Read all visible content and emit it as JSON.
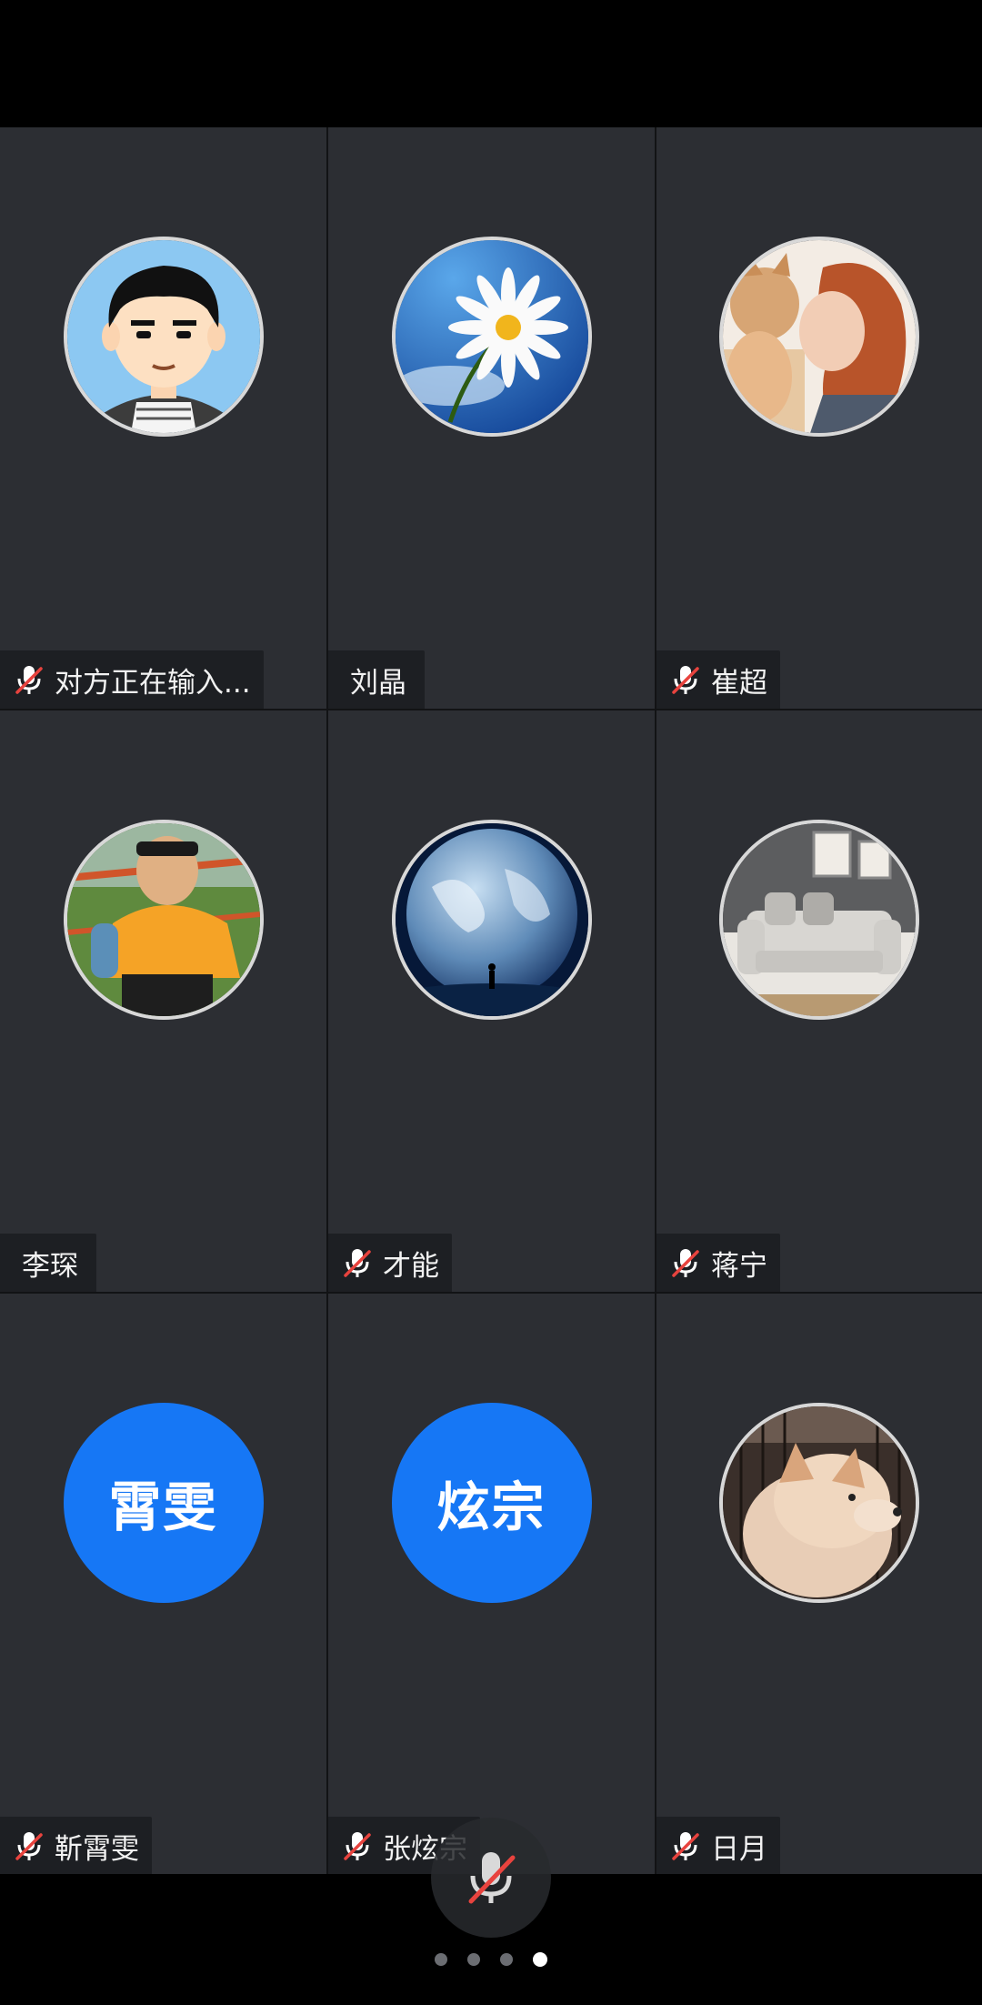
{
  "participants": [
    {
      "name": "对方正在输入...",
      "muted": true,
      "avatar": "cartoon-boy"
    },
    {
      "name": "刘晶",
      "muted": false,
      "avatar": "daisy-sky"
    },
    {
      "name": "崔超",
      "muted": true,
      "avatar": "woman-cat"
    },
    {
      "name": "李琛",
      "muted": false,
      "avatar": "kid-orange-shirt"
    },
    {
      "name": "才能",
      "muted": true,
      "avatar": "earth-globe"
    },
    {
      "name": "蒋宁",
      "muted": true,
      "avatar": "sofa-room"
    },
    {
      "name": "靳霄雯",
      "muted": true,
      "initials": "霄雯"
    },
    {
      "name": "张炫宗",
      "muted": true,
      "initials": "炫宗"
    },
    {
      "name": "日月",
      "muted": true,
      "avatar": "shiba-dog"
    }
  ],
  "colors": {
    "tile_bg": "#2c2e33",
    "initials_bg": "#1677f5",
    "mute_red": "#e8433e"
  },
  "pager": {
    "count": 4,
    "active_index": 3
  },
  "controls": {
    "mic_icon": "mic-off-icon"
  }
}
